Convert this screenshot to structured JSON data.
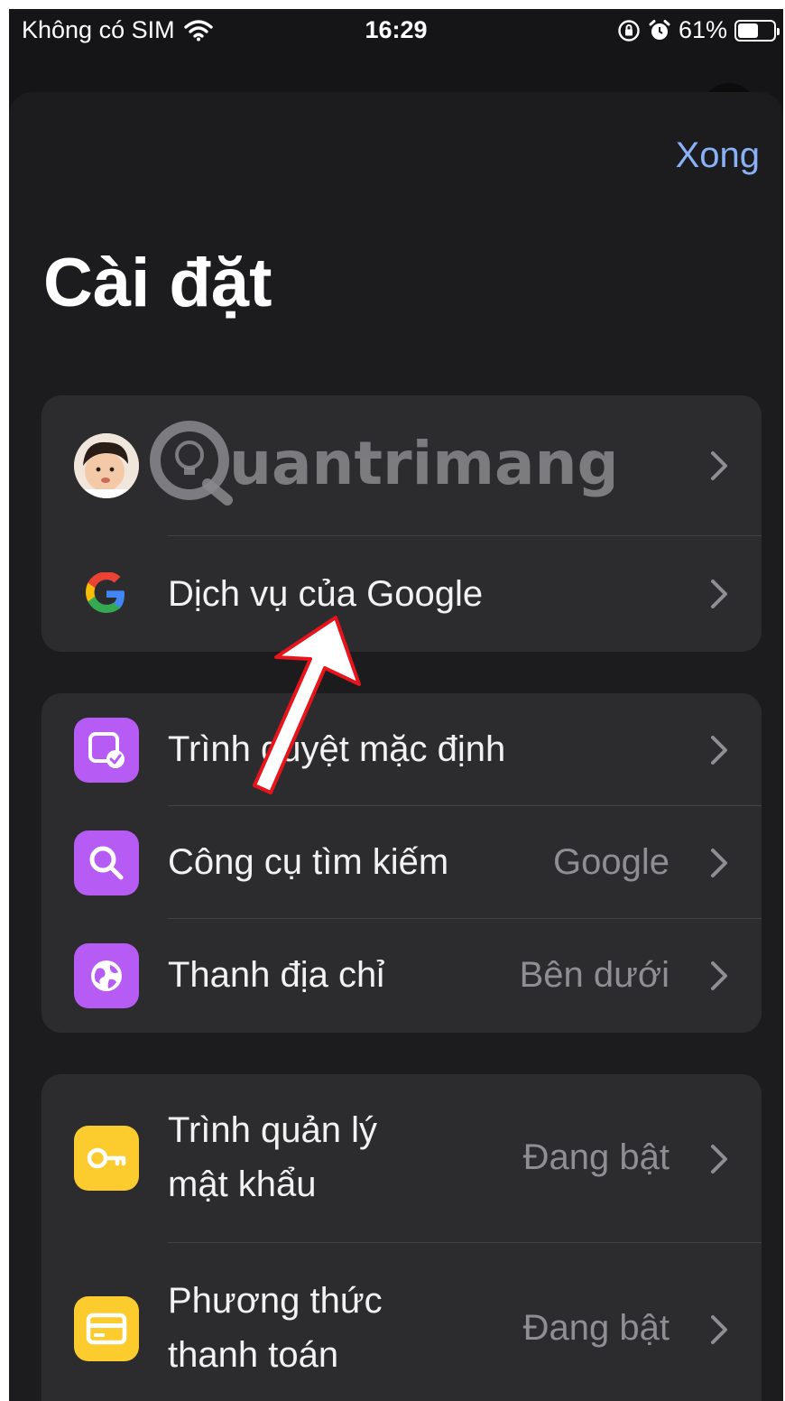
{
  "status_bar": {
    "carrier": "Không có SIM",
    "time": "16:29",
    "battery": "61%",
    "battery_level": 0.61
  },
  "header": {
    "done_label": "Xong",
    "title": "Cài đặt"
  },
  "watermark_text": "uantrimang",
  "groups": [
    {
      "rows": [
        {
          "label": "",
          "value": "",
          "icon": "profile-avatar"
        },
        {
          "label": "Dịch vụ của Google",
          "value": "",
          "icon": "google-logo-icon"
        }
      ]
    },
    {
      "rows": [
        {
          "label": "Trình duyệt mặc định",
          "value": "",
          "icon": "default-browser-icon"
        },
        {
          "label": "Công cụ tìm kiếm",
          "value": "Google",
          "icon": "search-icon"
        },
        {
          "label": "Thanh địa chỉ",
          "value": "Bên dưới",
          "icon": "globe-icon"
        }
      ]
    },
    {
      "rows": [
        {
          "label_line1": "Trình quản lý",
          "label_line2": "mật khẩu",
          "value": "Đang bật",
          "icon": "key-icon"
        },
        {
          "label_line1": "Phương thức",
          "label_line2": "thanh toán",
          "value": "Đang bật",
          "icon": "credit-card-icon"
        }
      ]
    }
  ],
  "colors": {
    "background": "#151517",
    "sheet": "#1c1c1e",
    "group": "#2c2c2e",
    "accent_blue": "#8ab0f5",
    "purple_icon": "#b65cf5",
    "yellow_icon": "#fccc2e",
    "annotation_red": "#e8141b"
  }
}
